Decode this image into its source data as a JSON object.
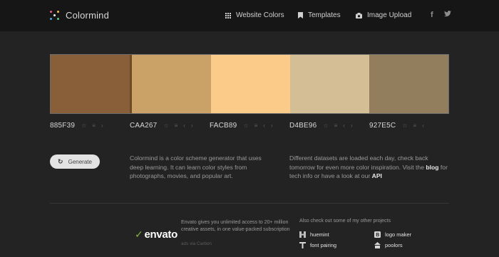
{
  "header": {
    "brand": "Colormind",
    "nav": [
      {
        "label": "Website Colors",
        "icon": "grid-icon"
      },
      {
        "label": "Templates",
        "icon": "bookmark-icon"
      },
      {
        "label": "Image Upload",
        "icon": "camera-icon"
      }
    ],
    "social": [
      {
        "label": "f",
        "icon": "facebook-icon"
      },
      {
        "label": "t",
        "icon": "twitter-icon"
      }
    ]
  },
  "palette": {
    "swatches": [
      {
        "hex": "885F39",
        "color": "#885F39",
        "tools": [
          "☆",
          "≡",
          "›"
        ]
      },
      {
        "hex": "CAA267",
        "color": "#CAA267",
        "tools": [
          "☆",
          "≡",
          "‹",
          "›"
        ]
      },
      {
        "hex": "FACB89",
        "color": "#FACB89",
        "tools": [
          "☆",
          "≡",
          "‹",
          "›"
        ]
      },
      {
        "hex": "D4BE96",
        "color": "#D4BE96",
        "tools": [
          "☆",
          "≡",
          "‹",
          "›"
        ]
      },
      {
        "hex": "927E5C",
        "color": "#927E5C",
        "tools": [
          "☆",
          "≡",
          "‹"
        ]
      }
    ]
  },
  "generate": {
    "label": "Generate",
    "icon": "refresh-icon"
  },
  "description": {
    "left": "Colormind is a color scheme generator that uses deep learning. It can learn color styles from photographs, movies, and popular art.",
    "right_pre": "Different datasets are loaded each day, check back tomorrow for even more color inspiration. Visit the ",
    "right_blog": "blog",
    "right_mid": " for tech info or have a look at our ",
    "right_api": "API"
  },
  "footer": {
    "envato_logo": "envato",
    "envato_text": "Envato gives you unlimited access to 20+ million creative assets, in one value-packed subscription",
    "envato_sub": "ads via Carbon",
    "also_label": "Also check out some of my other projects",
    "projects": [
      {
        "label": "huemint",
        "icon": "huemint-icon"
      },
      {
        "label": "logo maker",
        "icon": "logo-maker-icon"
      },
      {
        "label": "font pairing",
        "icon": "font-pairing-icon"
      },
      {
        "label": "poolors",
        "icon": "poolors-icon"
      }
    ]
  },
  "colors": {
    "background": "#232323",
    "header": "#161616",
    "envato_green": "#82B541"
  }
}
